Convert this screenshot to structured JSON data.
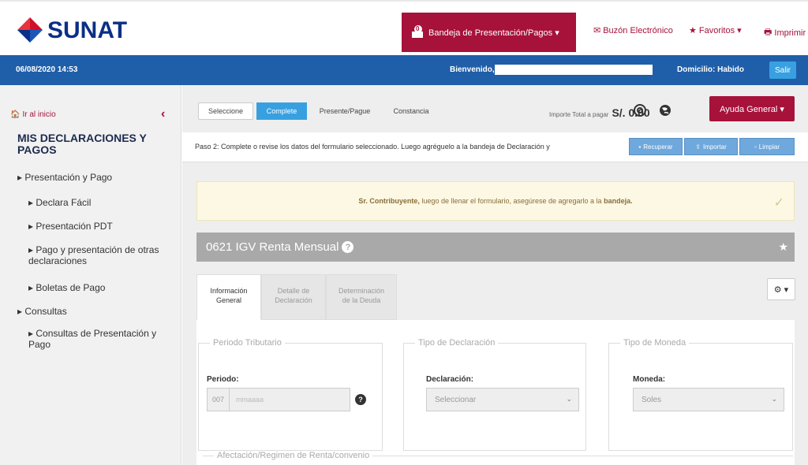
{
  "header": {
    "logo_text": "SUNAT",
    "bandeja_label": "Bandeja de Presentación/Pagos ▾",
    "bandeja_count": "0",
    "buzon_label": "Buzón Electrónico",
    "favoritos_label": "Favoritos ▾",
    "imprimir_label": "Imprimir",
    "colors": {
      "brand_red": "#a6123a",
      "brand_blue": "#1f5ea8",
      "logo_navy": "#0b2f86"
    }
  },
  "bluebar": {
    "datetime": "06/08/2020 14:53",
    "welcome": "Bienvenido,",
    "domicilio": "Domicilio: Habido",
    "salir": "Salir"
  },
  "sidebar": {
    "home_link": "Ir al inicio",
    "collapse_icon": "chevron-left-icon",
    "title": "MIS DECLARACIONES Y PAGOS",
    "items": [
      {
        "label": "▸ Presentación y Pago"
      },
      {
        "label": "▸ Declara Fácil"
      },
      {
        "label": "▸ Presentación PDT"
      },
      {
        "label": "▸ Pago y presentación de otras declaraciones"
      },
      {
        "label": "▸ Boletas de Pago"
      },
      {
        "label": "▸ Consultas"
      },
      {
        "label": "▸ Consultas de Presentación y Pago"
      }
    ]
  },
  "wizard": {
    "steps": [
      "Seleccione",
      "Complete",
      "Presente/Pague",
      "Constancia"
    ],
    "total_label": "Importe Total a pagar",
    "total_value": "S/. 0.00",
    "ayuda": "Ayuda General ▾"
  },
  "paso": {
    "text": "Paso 2: Complete o revise los datos del formulario seleccionado. Luego agréguelo a la bandeja de Declaración y",
    "btn_recuperar": "Recuperar",
    "btn_importar": "Importar",
    "btn_limpiar": "Limpiar"
  },
  "alert": {
    "prefix": "Sr. Contribuyente,",
    "body": " luego de llenar el formulario, asegúrese de agregarlo a la ",
    "bold_end": "bandeja."
  },
  "form": {
    "title": "0621 IGV Renta Mensual",
    "tabs": [
      {
        "line1": "Información",
        "line2": "General"
      },
      {
        "line1": "Detalle de",
        "line2": "Declaración"
      },
      {
        "line1": "Determinación",
        "line2": "de la Deuda"
      }
    ],
    "gear_label": "⚙ ▾",
    "periodo": {
      "legend": "Periodo Tributario",
      "label": "Periodo:",
      "prefix": "007",
      "placeholder": "mmaaaa"
    },
    "declaracion": {
      "legend": "Tipo de Declaración",
      "label": "Declaración:",
      "value": "Seleccionar"
    },
    "moneda": {
      "legend": "Tipo de Moneda",
      "label": "Moneda:",
      "value": "Soles"
    },
    "afectacion_legend": "Afectación/Regimen de Renta/convenio"
  }
}
